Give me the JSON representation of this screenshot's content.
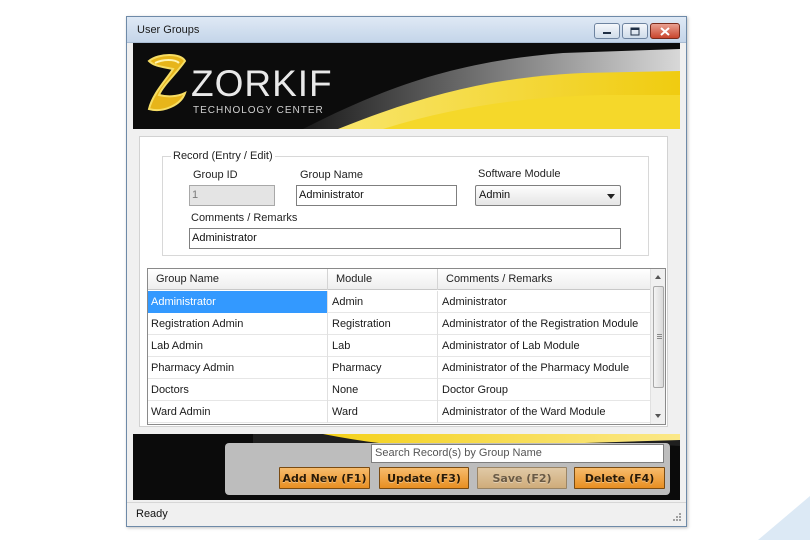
{
  "window": {
    "title": "User Groups",
    "controls": {
      "minimize": "minimize-icon",
      "maximize": "maximize-icon",
      "close": "close-icon"
    }
  },
  "banner": {
    "brand": "ZORKIF",
    "tagline": "TECHNOLOGY CENTER",
    "colors": {
      "accent": "#f2d21a",
      "background": "#0c0c0c"
    }
  },
  "form": {
    "group_title": "Record (Entry / Edit)",
    "group_id": {
      "label": "Group ID",
      "value": "1"
    },
    "group_name": {
      "label": "Group Name",
      "value": "Administrator"
    },
    "software_module": {
      "label": "Software Module",
      "value": "Admin"
    },
    "comments": {
      "label": "Comments / Remarks",
      "value": "Administrator"
    }
  },
  "grid": {
    "columns": [
      "Group Name",
      "Module",
      "Comments / Remarks"
    ],
    "rows": [
      [
        "Administrator",
        "Admin",
        "Administrator"
      ],
      [
        "Registration Admin",
        "Registration",
        "Administrator of the Registration Module"
      ],
      [
        "Lab Admin",
        "Lab",
        "Administrator of Lab Module"
      ],
      [
        "Pharmacy Admin",
        "Pharmacy",
        "Administrator of the Pharmacy Module"
      ],
      [
        "Doctors",
        "None",
        "Doctor Group"
      ],
      [
        "Ward Admin",
        "Ward",
        "Administrator of the Ward Module"
      ]
    ],
    "selection_color": "#3399ff"
  },
  "actions": {
    "search_placeholder": "Search Record(s) by Group Name",
    "add_new": "Add New (F1)",
    "update": "Update (F3)",
    "save": "Save (F2)",
    "delete": "Delete (F4)",
    "button_color": "#f0a040"
  },
  "status": {
    "text": "Ready"
  }
}
